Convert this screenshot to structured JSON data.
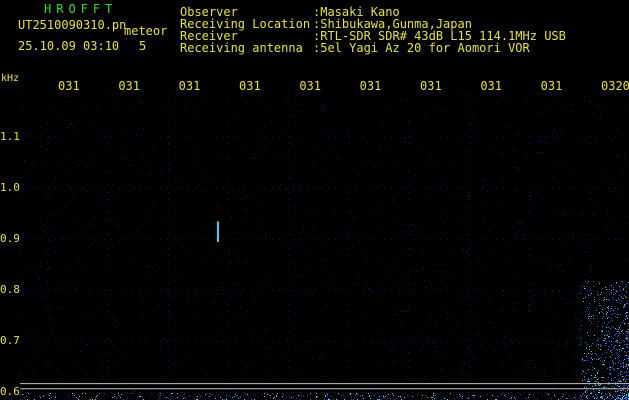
{
  "header": {
    "app_title": "HROFFT",
    "filename": "UT2510090310.pn",
    "datetime": "25.10.09 03:10",
    "meteor_label": "meteor",
    "extra": "5",
    "info": [
      {
        "label": "Observer",
        "value": ":Masaki Kano"
      },
      {
        "label": "Receiving Location",
        "value": ":Shibukawa,Gunma,Japan"
      },
      {
        "label": "Receiver",
        "value": ":RTL-SDR SDR# 43dB L15 114.1MHz USB"
      },
      {
        "label": "Receiving antenna",
        "value": ":5el Yagi Az 20 for Aomori VOR"
      }
    ]
  },
  "chart_data": {
    "type": "heatmap",
    "ylabel": "kHz",
    "y_ticks": [
      "1.1",
      "1.0",
      "0.9",
      "0.8",
      "0.7",
      "0.6"
    ],
    "y_range": [
      0.585,
      1.185
    ],
    "x_ticks": [
      "031",
      "031",
      "031",
      "031",
      "031",
      "031",
      "031",
      "031",
      "031",
      "0320"
    ],
    "grid": true,
    "colors": {
      "background": "#000000",
      "noise": "#0a1c6e",
      "signal": "#3ad8e8",
      "tick_text": "#e8e23a",
      "title": "#23e123",
      "reference_line": "#c0c0c0"
    },
    "reference_lines_khz": [
      0.617,
      0.607
    ],
    "meteor_events": [
      {
        "time_frac": 0.325,
        "khz_from": 0.935,
        "khz_to": 0.895
      }
    ]
  }
}
